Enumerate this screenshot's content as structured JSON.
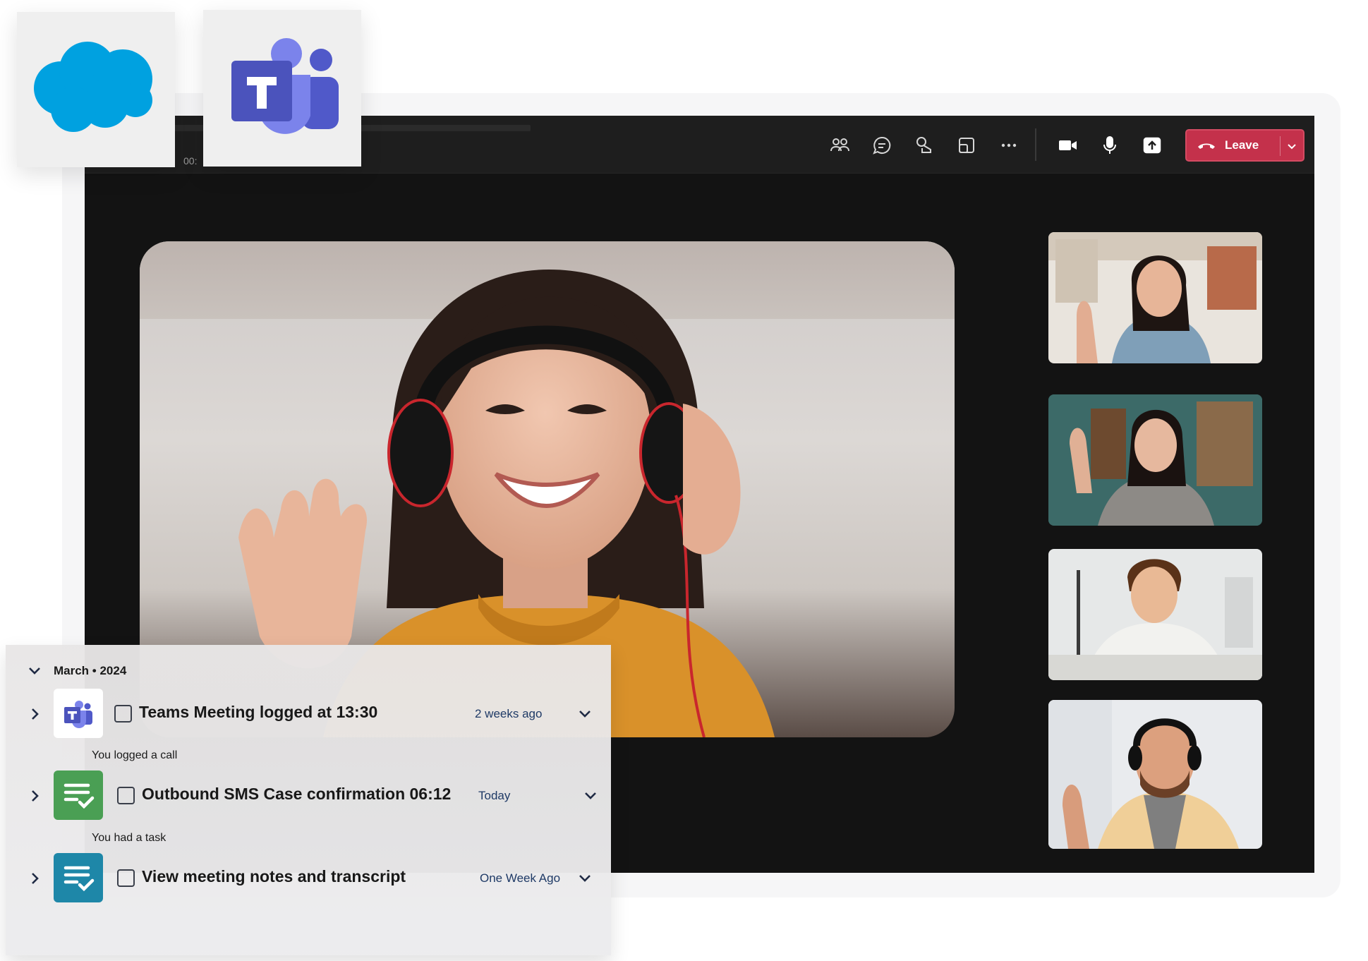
{
  "teams_window": {
    "timer_text": "00:",
    "leave_label": "Leave",
    "colors": {
      "leave": "#c4314b",
      "background": "#131313",
      "toolbar": "#1e1e1e"
    },
    "toolbar_icons": [
      "people-icon",
      "chat-icon",
      "react-icon",
      "view-icon",
      "more-icon",
      "camera-icon",
      "mic-icon",
      "share-icon"
    ]
  },
  "logos": [
    {
      "name": "salesforce-logo",
      "color": "#00a1e0"
    },
    {
      "name": "microsoft-teams-logo",
      "color": "#5059c9"
    }
  ],
  "activity": {
    "group_label": "March • 2024",
    "items": [
      {
        "icon": "teams-icon",
        "title": "Teams Meeting logged at  13:30",
        "when": "2 weeks ago",
        "subtitle": "You logged a call"
      },
      {
        "icon": "task-icon",
        "icon_color": "#4a9f54",
        "title": "Outbound SMS Case confirmation 06:12",
        "when": "Today",
        "subtitle": "You had a task"
      },
      {
        "icon": "task-icon",
        "icon_color": "#1e87a8",
        "title": "View meeting notes and transcript",
        "when": "One Week Ago",
        "subtitle": ""
      }
    ]
  }
}
